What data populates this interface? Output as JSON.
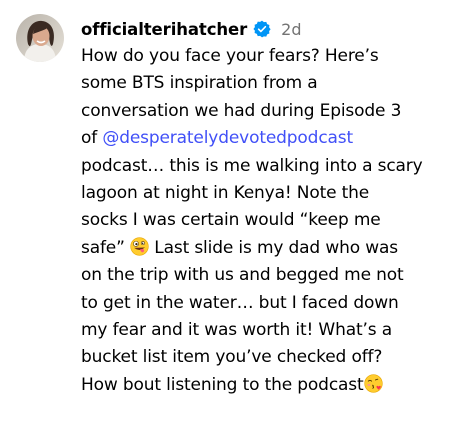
{
  "post": {
    "username": "officialterihatcher",
    "timestamp": "2d",
    "verified_icon": "verified-badge-icon",
    "caption": {
      "line1": "How do you face your fears? Here’s",
      "line2": "some BTS inspiration from a",
      "line3": "conversation we had during Episode 3",
      "line4_prefix": "of ",
      "mention": "@desperatelydevotedpodcast",
      "line5": "podcast… this is me walking into a scary",
      "line6": "lagoon at night in Kenya! Note the",
      "line7": "socks I was certain would “keep me",
      "line8_before_emoji": "safe” ",
      "line8_after_emoji": " Last slide is my dad who was",
      "line9": "on the trip with us and begged me not",
      "line10": "to get in the water… but I faced down",
      "line11": "my fear and it was worth it! What’s a",
      "line12": "bucket list item you’ve checked off?",
      "line13": "How bout listening to the podcast"
    },
    "emojis": [
      "zany-face-emoji",
      "face-blowing-kiss-emoji"
    ],
    "colors": {
      "mention": "#4150f7",
      "verified": "#0095f6",
      "timestamp": "#737373"
    }
  }
}
